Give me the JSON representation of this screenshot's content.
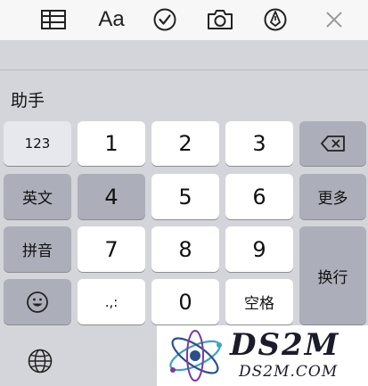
{
  "toolbar": {
    "icons": [
      "table-icon",
      "format-text-icon",
      "checklist-icon",
      "camera-icon",
      "markup-pen-icon",
      "close-icon"
    ],
    "format_label": "Aa"
  },
  "candidate": {
    "text": "助手"
  },
  "keyboard": {
    "mode_123": "123",
    "english": "英文",
    "pinyin": "拼音",
    "more": "更多",
    "return": "换行",
    "punct": ".,:",
    "space": "空格",
    "digits": [
      "1",
      "2",
      "3",
      "4",
      "5",
      "6",
      "7",
      "8",
      "9",
      "0"
    ],
    "icons": [
      "backspace-icon",
      "emoji-icon",
      "globe-icon"
    ]
  },
  "watermark": {
    "title": "DS2M",
    "url": "DS2M.COM"
  },
  "colors": {
    "toolbar_bg": "#f7f7f7",
    "keyboard_bg": "#d4d5da",
    "key_white": "#ffffff",
    "key_gray": "#acafb9",
    "watermark_accent": "#3aa3c8"
  }
}
